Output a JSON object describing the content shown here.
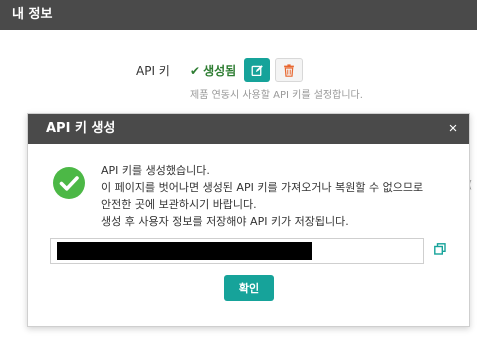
{
  "page": {
    "title": "내 정보"
  },
  "api_section": {
    "label": "API 키",
    "status": "생성됨",
    "help_text": "제품 연동시 사용할 API 키를 설정합니다.",
    "edit_icon": "edit-icon",
    "delete_icon": "trash-icon",
    "accent_color": "#16a39a",
    "delete_icon_color": "#e8672f"
  },
  "modal": {
    "title": "API 키 생성",
    "close_symbol": "×",
    "icon": "success-check-icon",
    "icon_color": "#4cb846",
    "messages": [
      "API 키를 생성했습니다.",
      "이 페이지를 벗어나면 생성된 API 키를 가져오거나 복원할 수 없으므로",
      "안전한 곳에 보관하시기 바랍니다.",
      "생성 후 사용자 정보를 저장해야 API 키가 저장됩니다."
    ],
    "api_key": "",
    "copy_icon": "copy-icon",
    "confirm_label": "확인"
  }
}
